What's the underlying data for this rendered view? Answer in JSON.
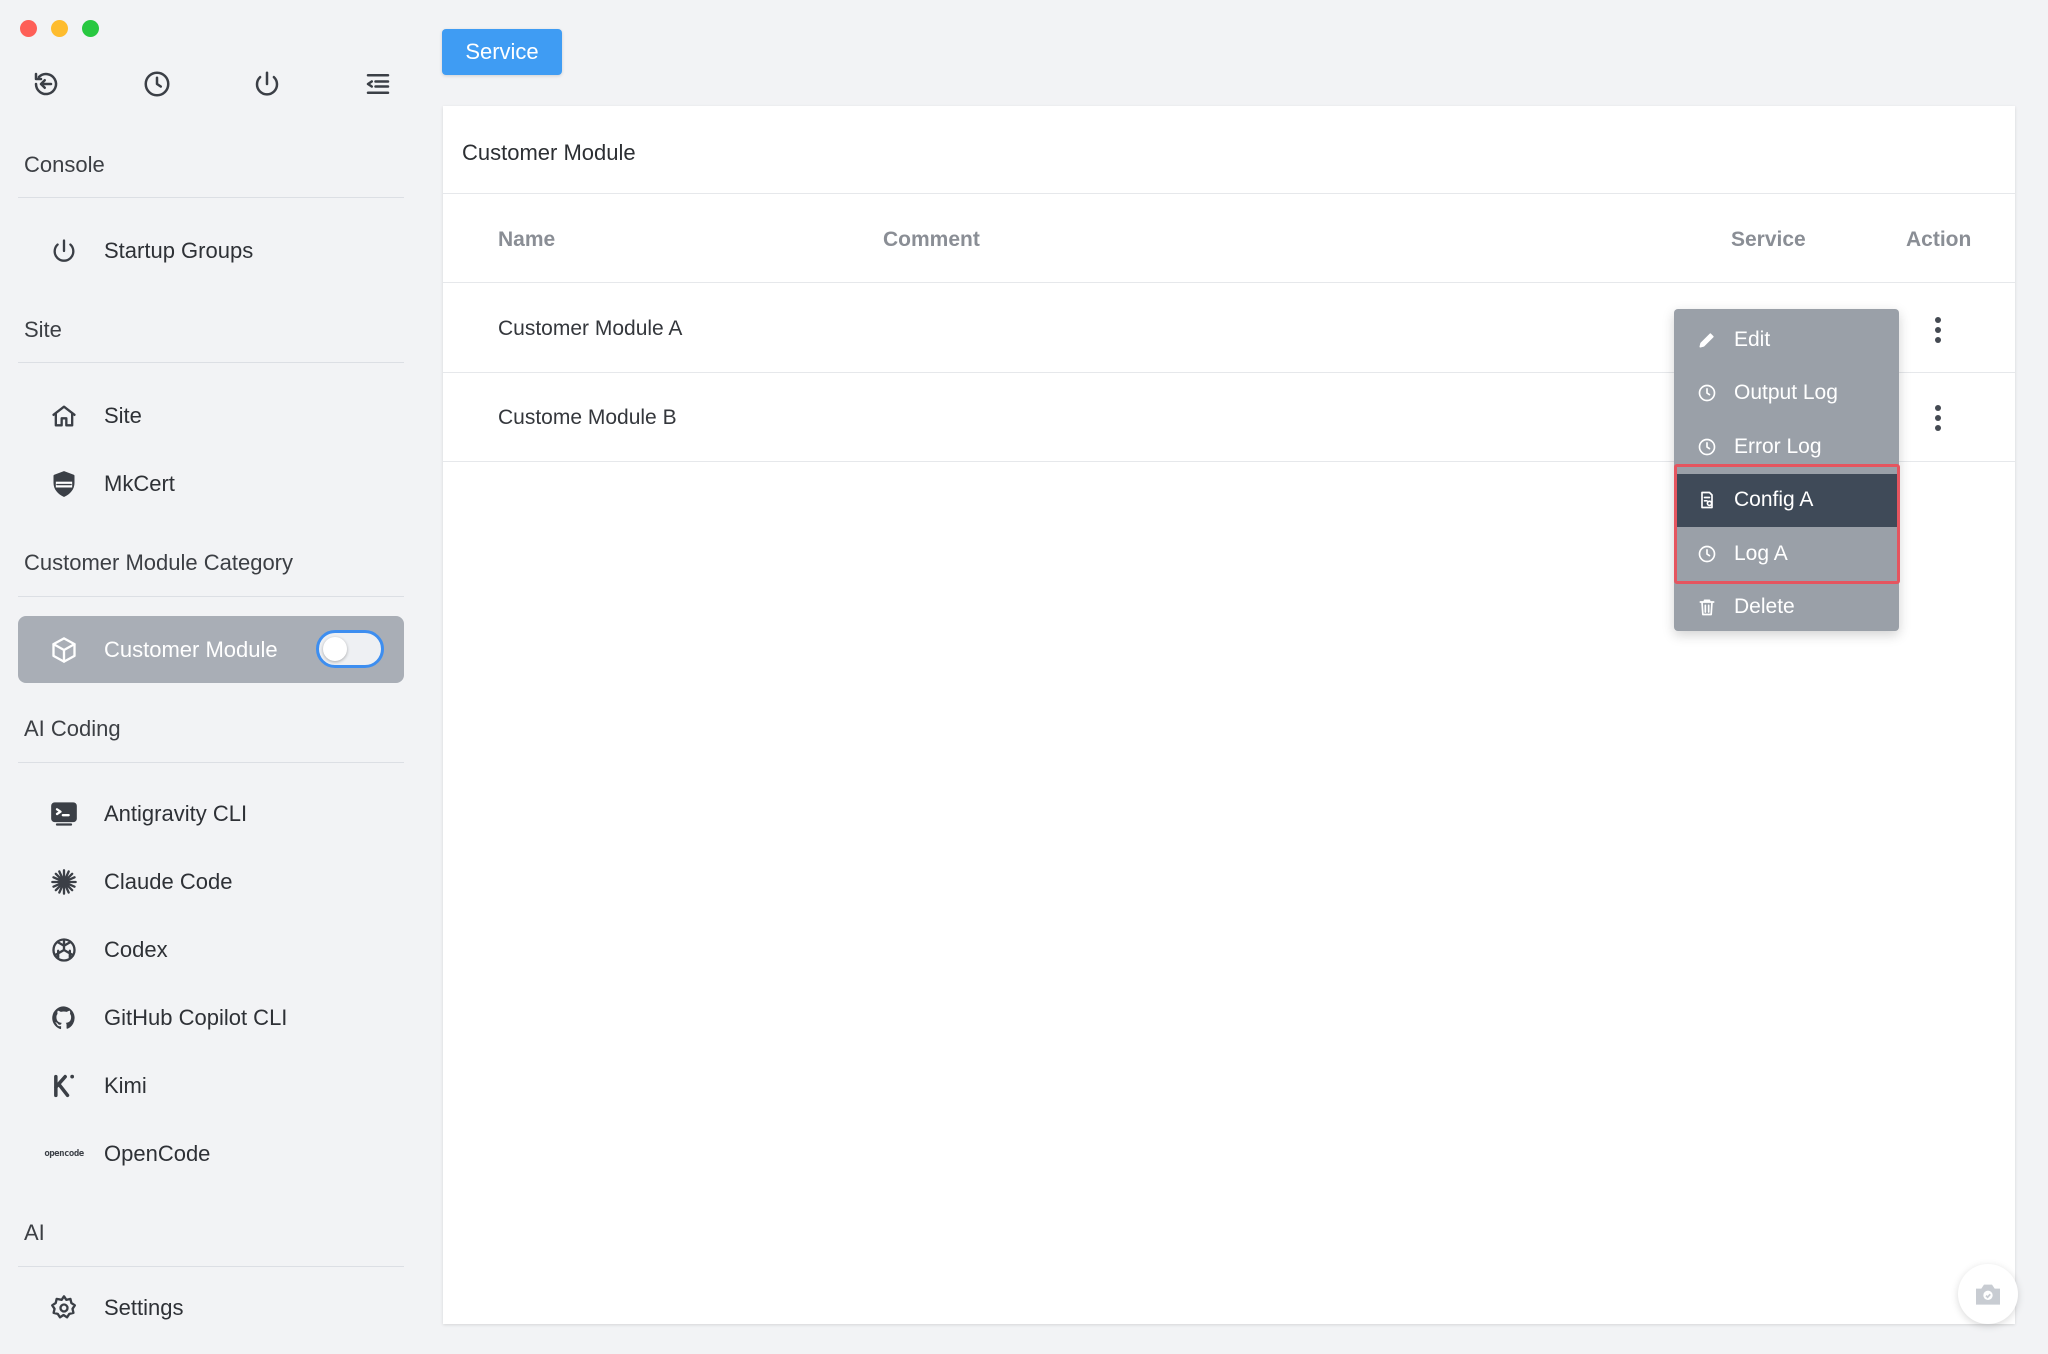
{
  "sidebar": {
    "toolbar": [
      {
        "icon": "back-icon"
      },
      {
        "icon": "history-icon"
      },
      {
        "icon": "power-icon"
      },
      {
        "icon": "collapse-menu-icon"
      }
    ],
    "sections": {
      "console": "Console",
      "site": "Site",
      "customer_module_category": "Customer Module Category",
      "ai_coding": "AI Coding",
      "ai": "AI"
    },
    "items": {
      "startup_groups": {
        "label": "Startup Groups",
        "icon": "power-icon"
      },
      "site": {
        "label": "Site",
        "icon": "home-icon"
      },
      "mkcert": {
        "label": "MkCert",
        "icon": "ssl-shield-icon"
      },
      "customer_module": {
        "label": "Customer Module",
        "icon": "cube-icon",
        "toggle_on": false
      },
      "antigravity": {
        "label": "Antigravity CLI",
        "icon": "terminal-icon"
      },
      "claude": {
        "label": "Claude Code",
        "icon": "sparkle-icon"
      },
      "codex": {
        "label": "Codex",
        "icon": "openai-icon"
      },
      "copilot": {
        "label": "GitHub Copilot CLI",
        "icon": "github-icon"
      },
      "kimi": {
        "label": "Kimi",
        "icon": "kimi-icon"
      },
      "opencode": {
        "label": "OpenCode",
        "icon": "opencode-icon",
        "icon_text": "opencode"
      },
      "settings": {
        "label": "Settings",
        "icon": "gear-icon"
      }
    }
  },
  "header": {
    "service_button": "Service"
  },
  "panel": {
    "title": "Customer Module",
    "columns": {
      "name": "Name",
      "comment": "Comment",
      "service": "Service",
      "action": "Action"
    },
    "rows": [
      {
        "name": "Customer Module A",
        "comment": ""
      },
      {
        "name": "Custome Module B",
        "comment": ""
      }
    ]
  },
  "menu": {
    "items": [
      {
        "label": "Edit",
        "icon": "pencil-icon"
      },
      {
        "label": "Output Log",
        "icon": "clock-icon"
      },
      {
        "label": "Error Log",
        "icon": "clock-icon"
      },
      {
        "label": "Config A",
        "icon": "config-file-icon",
        "selected": true
      },
      {
        "label": "Log A",
        "icon": "clock-icon"
      },
      {
        "label": "Delete",
        "icon": "trash-icon"
      }
    ]
  },
  "colors": {
    "accent": "#3f9cf3",
    "active_item": "#a9aeb6",
    "menu_bg": "#9aa0a8",
    "menu_selected": "#3f4a58",
    "highlight": "#e5555f"
  }
}
